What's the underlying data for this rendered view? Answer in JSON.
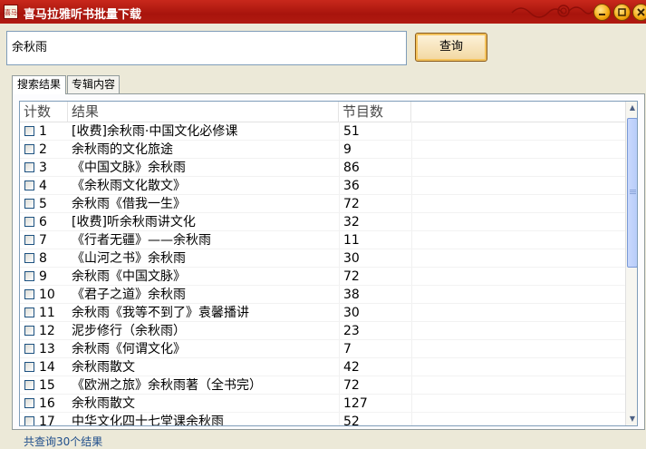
{
  "window": {
    "title": "喜马拉雅听书批量下载",
    "icon_text": "喜马"
  },
  "search": {
    "value": "余秋雨",
    "button_label": "查询"
  },
  "tabs": [
    {
      "label": "搜索结果",
      "active": true
    },
    {
      "label": "专辑内容",
      "active": false
    }
  ],
  "table": {
    "columns": [
      "计数",
      "结果",
      "节目数"
    ],
    "rows": [
      {
        "idx": "1",
        "name": "[收费]余秋雨·中国文化必修课",
        "count": "51"
      },
      {
        "idx": "2",
        "name": "余秋雨的文化旅途",
        "count": "9"
      },
      {
        "idx": "3",
        "name": "《中国文脉》余秋雨",
        "count": "86"
      },
      {
        "idx": "4",
        "name": "《余秋雨文化散文》",
        "count": "36"
      },
      {
        "idx": "5",
        "name": "余秋雨《借我一生》",
        "count": "72"
      },
      {
        "idx": "6",
        "name": "[收费]听余秋雨讲文化",
        "count": "32"
      },
      {
        "idx": "7",
        "name": "《行者无疆》——余秋雨",
        "count": "11"
      },
      {
        "idx": "8",
        "name": "《山河之书》余秋雨",
        "count": "30"
      },
      {
        "idx": "9",
        "name": "余秋雨《中国文脉》",
        "count": "72"
      },
      {
        "idx": "10",
        "name": "《君子之道》余秋雨",
        "count": "38"
      },
      {
        "idx": "11",
        "name": "余秋雨《我等不到了》袁馨播讲",
        "count": "30"
      },
      {
        "idx": "12",
        "name": "泥步修行（余秋雨）",
        "count": "23"
      },
      {
        "idx": "13",
        "name": "余秋雨《何谓文化》",
        "count": "7"
      },
      {
        "idx": "14",
        "name": "余秋雨散文",
        "count": "42"
      },
      {
        "idx": "15",
        "name": "《欧洲之旅》余秋雨著（全书完）",
        "count": "72"
      },
      {
        "idx": "16",
        "name": "余秋雨散文",
        "count": "127"
      },
      {
        "idx": "17",
        "name": "中华文化四十七堂课余秋雨",
        "count": "52"
      }
    ]
  },
  "status": {
    "text": "共查询30个结果"
  },
  "colors": {
    "titlebar": "#b11a10",
    "status_text": "#214f8c",
    "accent_button": "#f3c25c"
  }
}
